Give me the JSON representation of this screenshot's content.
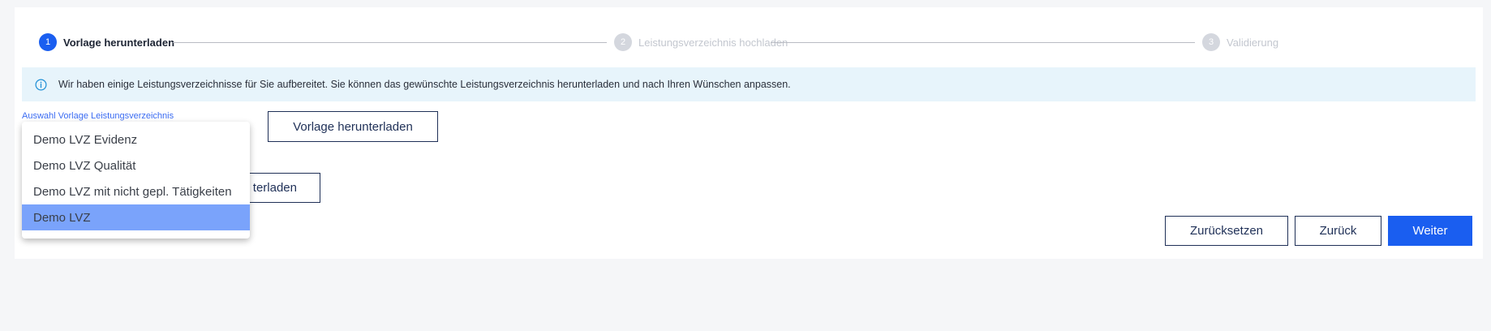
{
  "stepper": {
    "steps": [
      {
        "number": "1",
        "label": "Vorlage herunterladen",
        "state": "active"
      },
      {
        "number": "2",
        "label": "Leistungsverzeichnis hochladen",
        "state": "inactive"
      },
      {
        "number": "3",
        "label": "Validierung",
        "state": "inactive"
      }
    ]
  },
  "info": {
    "icon": "info-circle-icon",
    "text": "Wir haben einige Leistungsverzeichnisse für Sie aufbereitet. Sie können das gewünschte Leistungsverzeichnis herunterladen und nach Ihren Wünschen anpassen."
  },
  "template_select": {
    "label": "Auswahl Vorlage Leistungsverzeichnis",
    "options": [
      "Demo LVZ Evidenz",
      "Demo LVZ Qualität",
      "Demo LVZ mit nicht gepl. Tätigkeiten",
      "Demo LVZ"
    ],
    "selected_index": 3
  },
  "buttons": {
    "download_template": "Vorlage herunterladen",
    "download_second_partial": "terladen",
    "reset": "Zurücksetzen",
    "back": "Zurück",
    "next": "Weiter"
  },
  "colors": {
    "primary": "#1a5ef0",
    "info_bg": "#e7f4fb",
    "selected_option": "#7aa3fb",
    "outline": "#1f3057"
  }
}
